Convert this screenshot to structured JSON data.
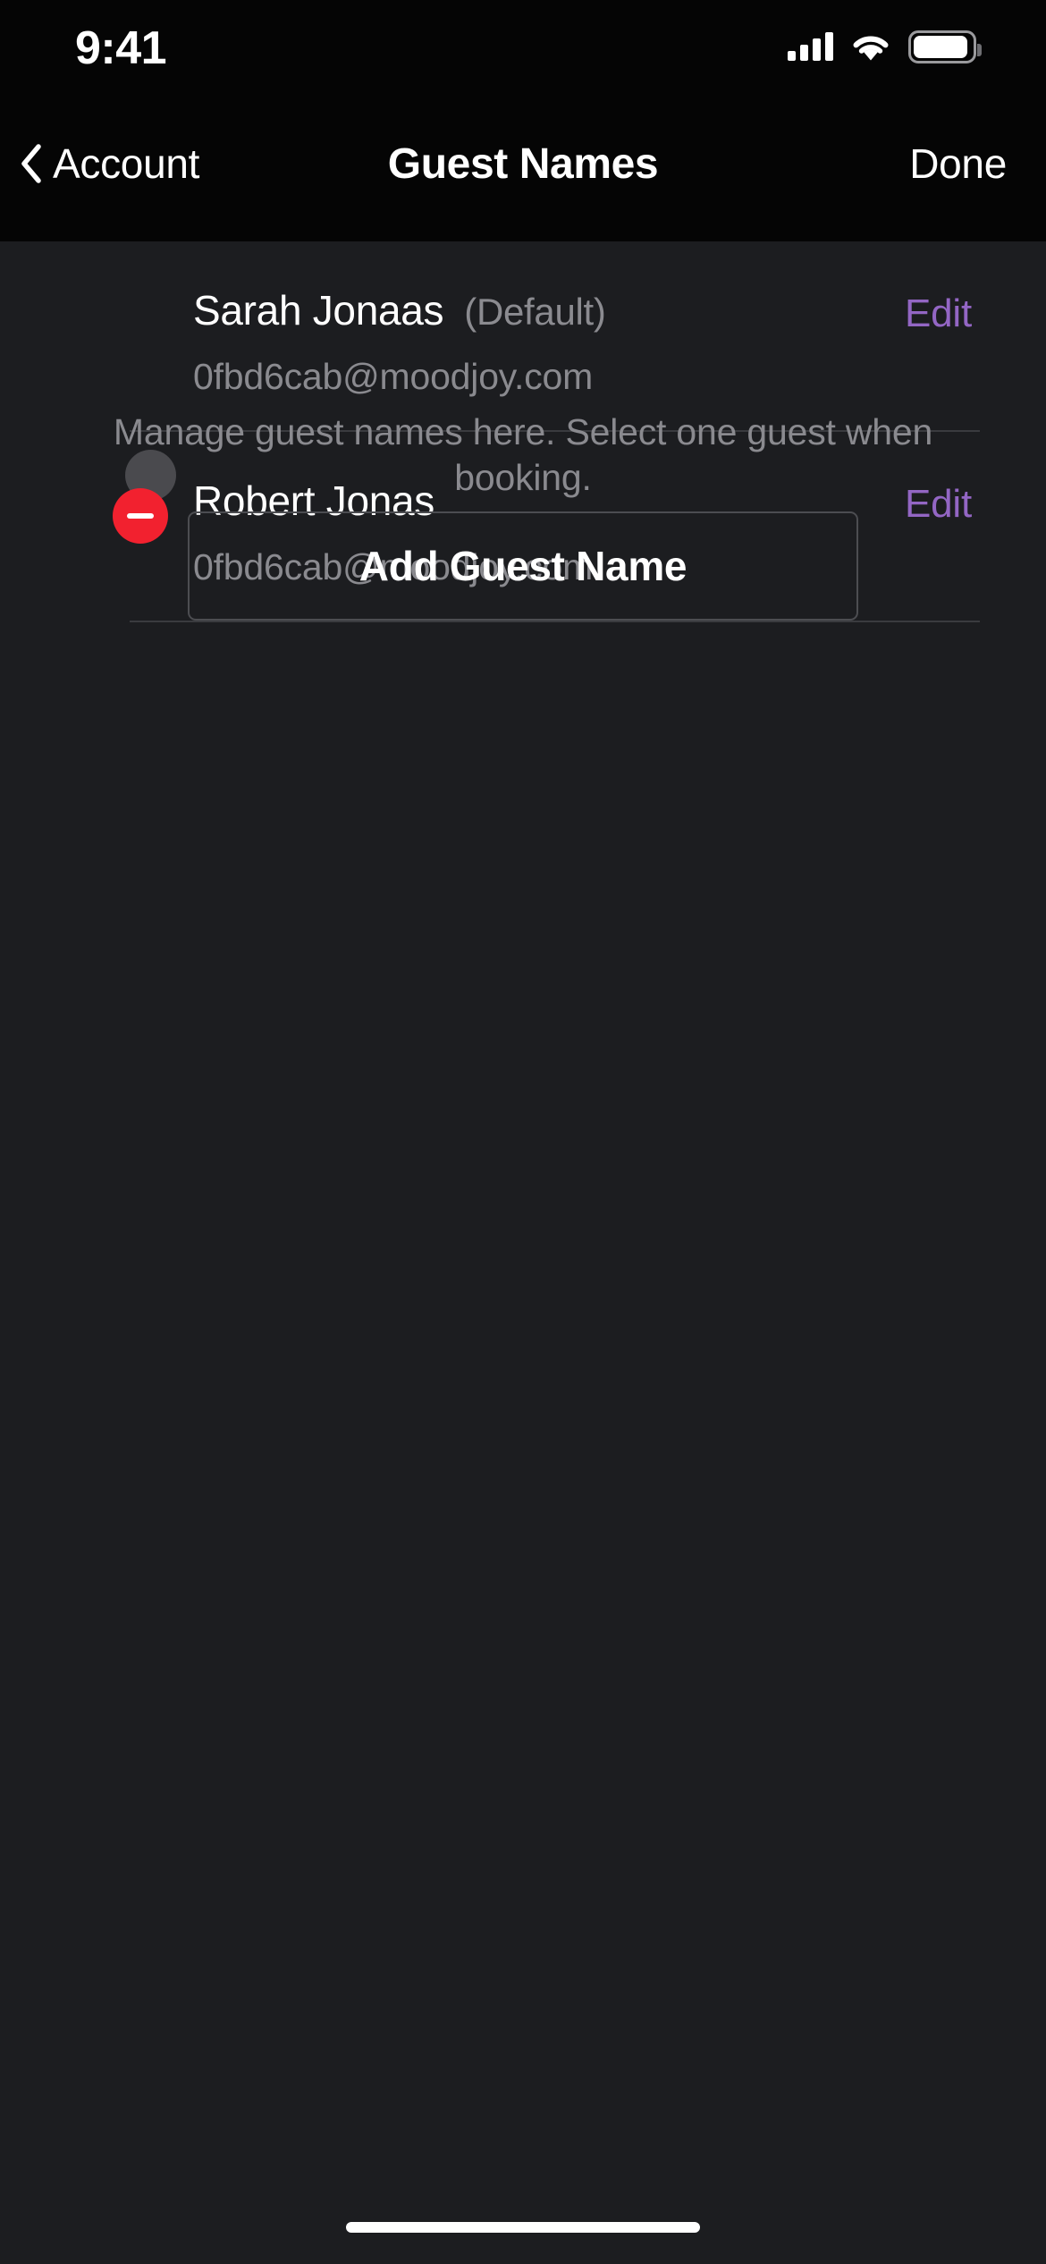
{
  "status_bar": {
    "time": "9:41",
    "icons": [
      "cellular-signal-icon",
      "wifi-icon",
      "battery-icon"
    ]
  },
  "nav_bar": {
    "back_label": "Account",
    "back_icon": "chevron-left-icon",
    "title": "Guest Names",
    "done_label": "Done"
  },
  "guests": [
    {
      "name": "Sarah Jonaas",
      "badge": "(Default)",
      "email": "0fbd6cab@moodjoy.com",
      "edit_label": "Edit",
      "deletable": false
    },
    {
      "name": "Robert Jonas",
      "badge": "",
      "email": "0fbd6cab@moodjoy.com",
      "edit_label": "Edit",
      "deletable": true,
      "delete_icon": "minus-circle-icon"
    }
  ],
  "footer": {
    "helper_text": "Manage guest names here. Select one guest when booking.",
    "add_button_label": "Add Guest Name"
  },
  "colors": {
    "background": "#1c1d20",
    "navbar_background": "#050505",
    "accent_edit": "#9366c4",
    "destructive": "#f2212f",
    "separator": "#3a3b3f",
    "secondary_text": "#8a8a8f",
    "primary_text": "#ffffff"
  },
  "home_indicator": "home-indicator"
}
